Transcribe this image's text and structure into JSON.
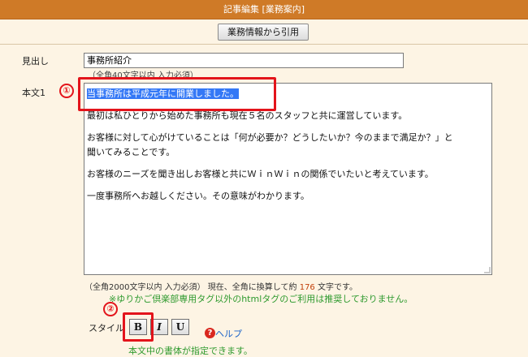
{
  "window": {
    "title": "記事編集 [業務案内]"
  },
  "toolbar": {
    "cite_label": "業務情報から引用"
  },
  "form": {
    "midashi": {
      "label": "見出し",
      "value": "事務所紹介",
      "hint": "（全角40文字以内 入力必須）"
    },
    "body": {
      "label": "本文1",
      "selected_text": "当事務所は平成元年に開業しました。",
      "lines": [
        "最初は私ひとりから始めた事務所も現在５名のスタッフと共に運営しています。",
        "お客様に対して心がけていることは「何が必要か？どうしたいか？今のままで満足か？」と",
        "聞いてみることです。",
        "お客様のニーズを聞き出しお客様と共にＷｉｎＷｉｎの関係でいたいと考えています。",
        "一度事務所へお越しください。その意味がわかります。"
      ],
      "count_prefix": "（全角2000文字以内 入力必須） 現在、全角に換算して約",
      "count_value": "176",
      "count_suffix": "文字です。",
      "notice": "※ゆりかご倶楽部専用タグ以外のhtmlタグのご利用は推奨しておりません。"
    },
    "style": {
      "label": "スタイル",
      "buttons": {
        "bold": "B",
        "italic": "I",
        "underline": "U"
      },
      "help_label": "ヘルプ",
      "help_icon": "?",
      "note": "本文中の書体が指定できます。"
    }
  },
  "annotations": {
    "marker1": "①",
    "marker2": "②"
  },
  "colors": {
    "titlebar": "#cf7a27",
    "accent_red": "#e3141b",
    "notice_green": "#2e9a2e",
    "selection": "#3478f6"
  }
}
